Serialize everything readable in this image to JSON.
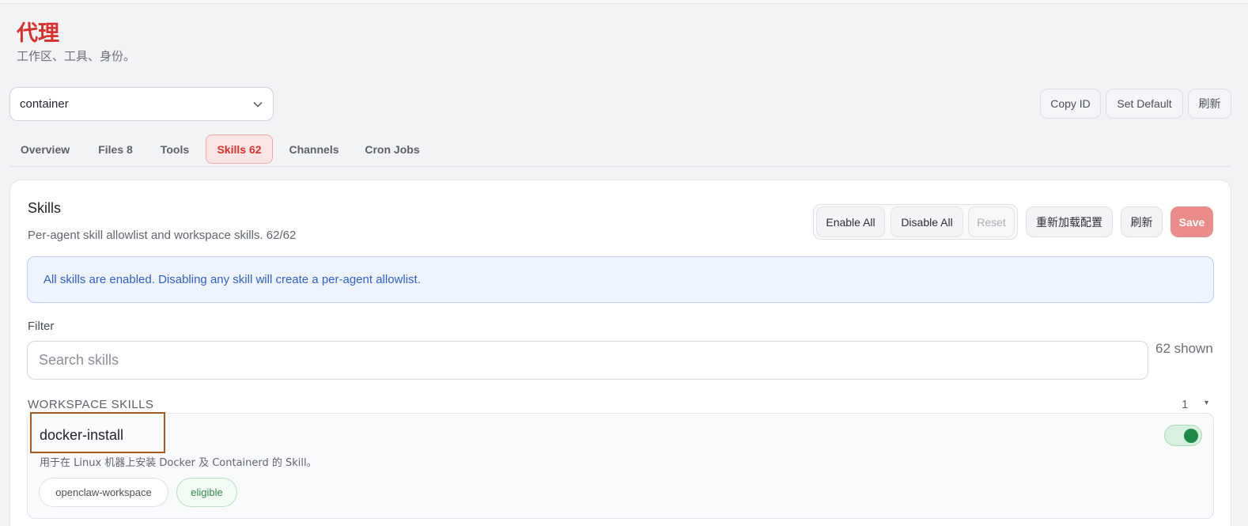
{
  "header": {
    "title": "代理",
    "subtitle": "工作区、工具、身份。"
  },
  "agent_select": {
    "value": "container"
  },
  "header_actions": {
    "copy_id": "Copy ID",
    "set_default": "Set Default",
    "refresh": "刷新"
  },
  "tabs": [
    {
      "label": "Overview"
    },
    {
      "label": "Files 8"
    },
    {
      "label": "Tools"
    },
    {
      "label": "Skills 62",
      "active": true
    },
    {
      "label": "Channels"
    },
    {
      "label": "Cron Jobs"
    }
  ],
  "skills_panel": {
    "title": "Skills",
    "subtitle": "Per-agent skill allowlist and workspace skills. 62/62",
    "enable_all": "Enable All",
    "disable_all": "Disable All",
    "reset": "Reset",
    "reload_config": "重新加载配置",
    "refresh": "刷新",
    "save": "Save",
    "notice": "All skills are enabled. Disabling any skill will create a per-agent allowlist.",
    "filter_label": "Filter",
    "search_placeholder": "Search skills",
    "search_value": "",
    "shown_count": "62 shown"
  },
  "workspace_group": {
    "label": "WORKSPACE SKILLS",
    "count": "1",
    "caret": "▾",
    "skills": [
      {
        "name": "docker-install",
        "description": "用于在 Linux 机器上安装 Docker 及 Containerd 的 Skill。",
        "source": "openclaw-workspace",
        "status": "eligible",
        "enabled": true
      }
    ]
  },
  "colors": {
    "accent": "#d9302c",
    "notice_text": "#2f5fc7",
    "toggle_on": "#1f8a45",
    "highlight_box": "#a65a1e"
  }
}
